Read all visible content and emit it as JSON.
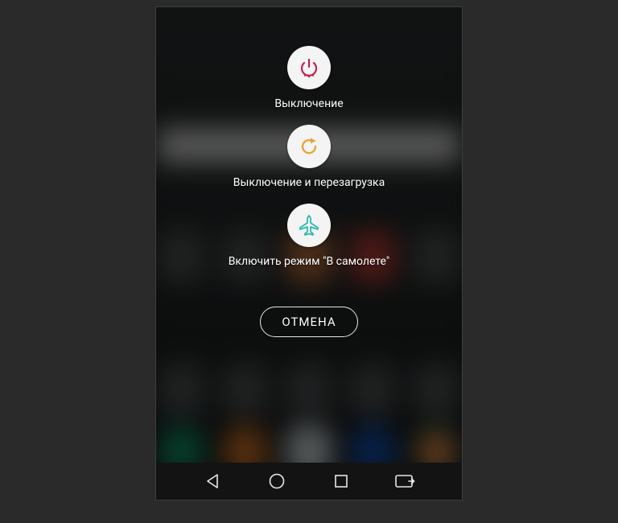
{
  "power_menu": {
    "items": [
      {
        "label": "Выключение",
        "icon_color": "#c2204b"
      },
      {
        "label": "Выключение и перезагрузка",
        "icon_color": "#e7a33e"
      },
      {
        "label": "Включить режим \"В самолете\"",
        "icon_color": "#2fb7b0"
      }
    ],
    "cancel_label": "ОТМЕНА"
  }
}
